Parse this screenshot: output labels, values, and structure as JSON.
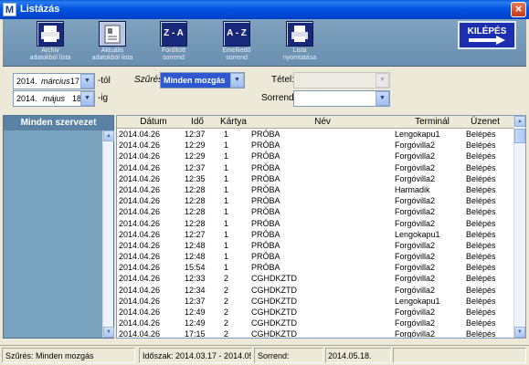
{
  "window": {
    "title": "Listázás",
    "icon_letter": "M",
    "close_glyph": "×"
  },
  "toolbar": {
    "buttons": [
      {
        "label1": "Archív",
        "label2": "adatokból lista",
        "icon": "printer-icon"
      },
      {
        "label1": "Aktuális",
        "label2": "adatokból lista",
        "icon": "document-icon"
      },
      {
        "label1": "Fordított",
        "label2": "sorrend",
        "icon": "sort-za-icon",
        "icon_text": "Z - A"
      },
      {
        "label1": "Emelkedő",
        "label2": "sorrend",
        "icon": "sort-az-icon",
        "icon_text": "A - Z"
      },
      {
        "label1": "Lista",
        "label2": "nyomtatása",
        "icon": "print-list-icon"
      }
    ],
    "exit_label": "KILÉPÉS"
  },
  "filters": {
    "from": {
      "year": "2014.",
      "month": "március",
      "day": "17",
      "suffix": "-tól"
    },
    "to": {
      "year": "2014.",
      "month": "május",
      "day": "18.",
      "suffix": "-ig"
    },
    "szures_label": "Szűrés",
    "szures_value": "Minden mozgás",
    "tetel_label": "Tétel:",
    "sorrend_label": "Sorrend:"
  },
  "left_panel": {
    "title": "Minden szervezet"
  },
  "table": {
    "headers": [
      "Dátum",
      "Idő",
      "Kártya",
      "Név",
      "Terminál",
      "Üzenet"
    ],
    "rows": [
      [
        "2014.04.26",
        "12:37",
        "1",
        "PRÓBA",
        "Lengokapu1",
        "Belépés"
      ],
      [
        "2014.04.26",
        "12:29",
        "1",
        "PRÓBA",
        "Forgóvilla2",
        "Belépés"
      ],
      [
        "2014.04.26",
        "12:29",
        "1",
        "PRÓBA",
        "Forgóvilla2",
        "Belépés"
      ],
      [
        "2014.04.26",
        "12:37",
        "1",
        "PRÓBA",
        "Forgóvilla2",
        "Belépés"
      ],
      [
        "2014.04.26",
        "12:35",
        "1",
        "PRÓBA",
        "Forgóvilla2",
        "Belépés"
      ],
      [
        "2014.04.26",
        "12:28",
        "1",
        "PRÓBA",
        "Harmadik",
        "Belépés"
      ],
      [
        "2014.04.26",
        "12:28",
        "1",
        "PRÓBA",
        "Forgóvilla2",
        "Belépés"
      ],
      [
        "2014.04.26",
        "12:28",
        "1",
        "PRÓBA",
        "Forgóvilla2",
        "Belépés"
      ],
      [
        "2014.04.26",
        "12:28",
        "1",
        "PRÓBA",
        "Forgóvilla2",
        "Belépés"
      ],
      [
        "2014.04.26",
        "12:27",
        "1",
        "PRÓBA",
        "Lengokapu1",
        "Belépés"
      ],
      [
        "2014.04.26",
        "12:48",
        "1",
        "PRÓBA",
        "Forgóvilla2",
        "Belépés"
      ],
      [
        "2014.04.26",
        "12:48",
        "1",
        "PRÓBA",
        "Forgóvilla2",
        "Belépés"
      ],
      [
        "2014.04.26",
        "15:54",
        "1",
        "PRÓBA",
        "Forgóvilla2",
        "Belépés"
      ],
      [
        "2014.04.26",
        "12:33",
        "2",
        "CGHDKZTD",
        "Forgóvilla2",
        "Belépés"
      ],
      [
        "2014.04.26",
        "12:34",
        "2",
        "CGHDKZTD",
        "Forgóvilla2",
        "Belépés"
      ],
      [
        "2014.04.26",
        "12:37",
        "2",
        "CGHDKZTD",
        "Lengokapu1",
        "Belépés"
      ],
      [
        "2014.04.26",
        "12:49",
        "2",
        "CGHDKZTD",
        "Forgóvilla2",
        "Belépés"
      ],
      [
        "2014.04.26",
        "12:49",
        "2",
        "CGHDKZTD",
        "Forgóvilla2",
        "Belépés"
      ],
      [
        "2014.04.26",
        "17:15",
        "2",
        "CGHDKZTD",
        "Forgóvilla2",
        "Belépés"
      ]
    ]
  },
  "status": {
    "szures": "Szűrés: Minden mozgás",
    "idoszak": "Időszak: 2014.03.17 - 2014.05.1",
    "sorrend": "Sorrend:",
    "date": "2014.05.18."
  }
}
